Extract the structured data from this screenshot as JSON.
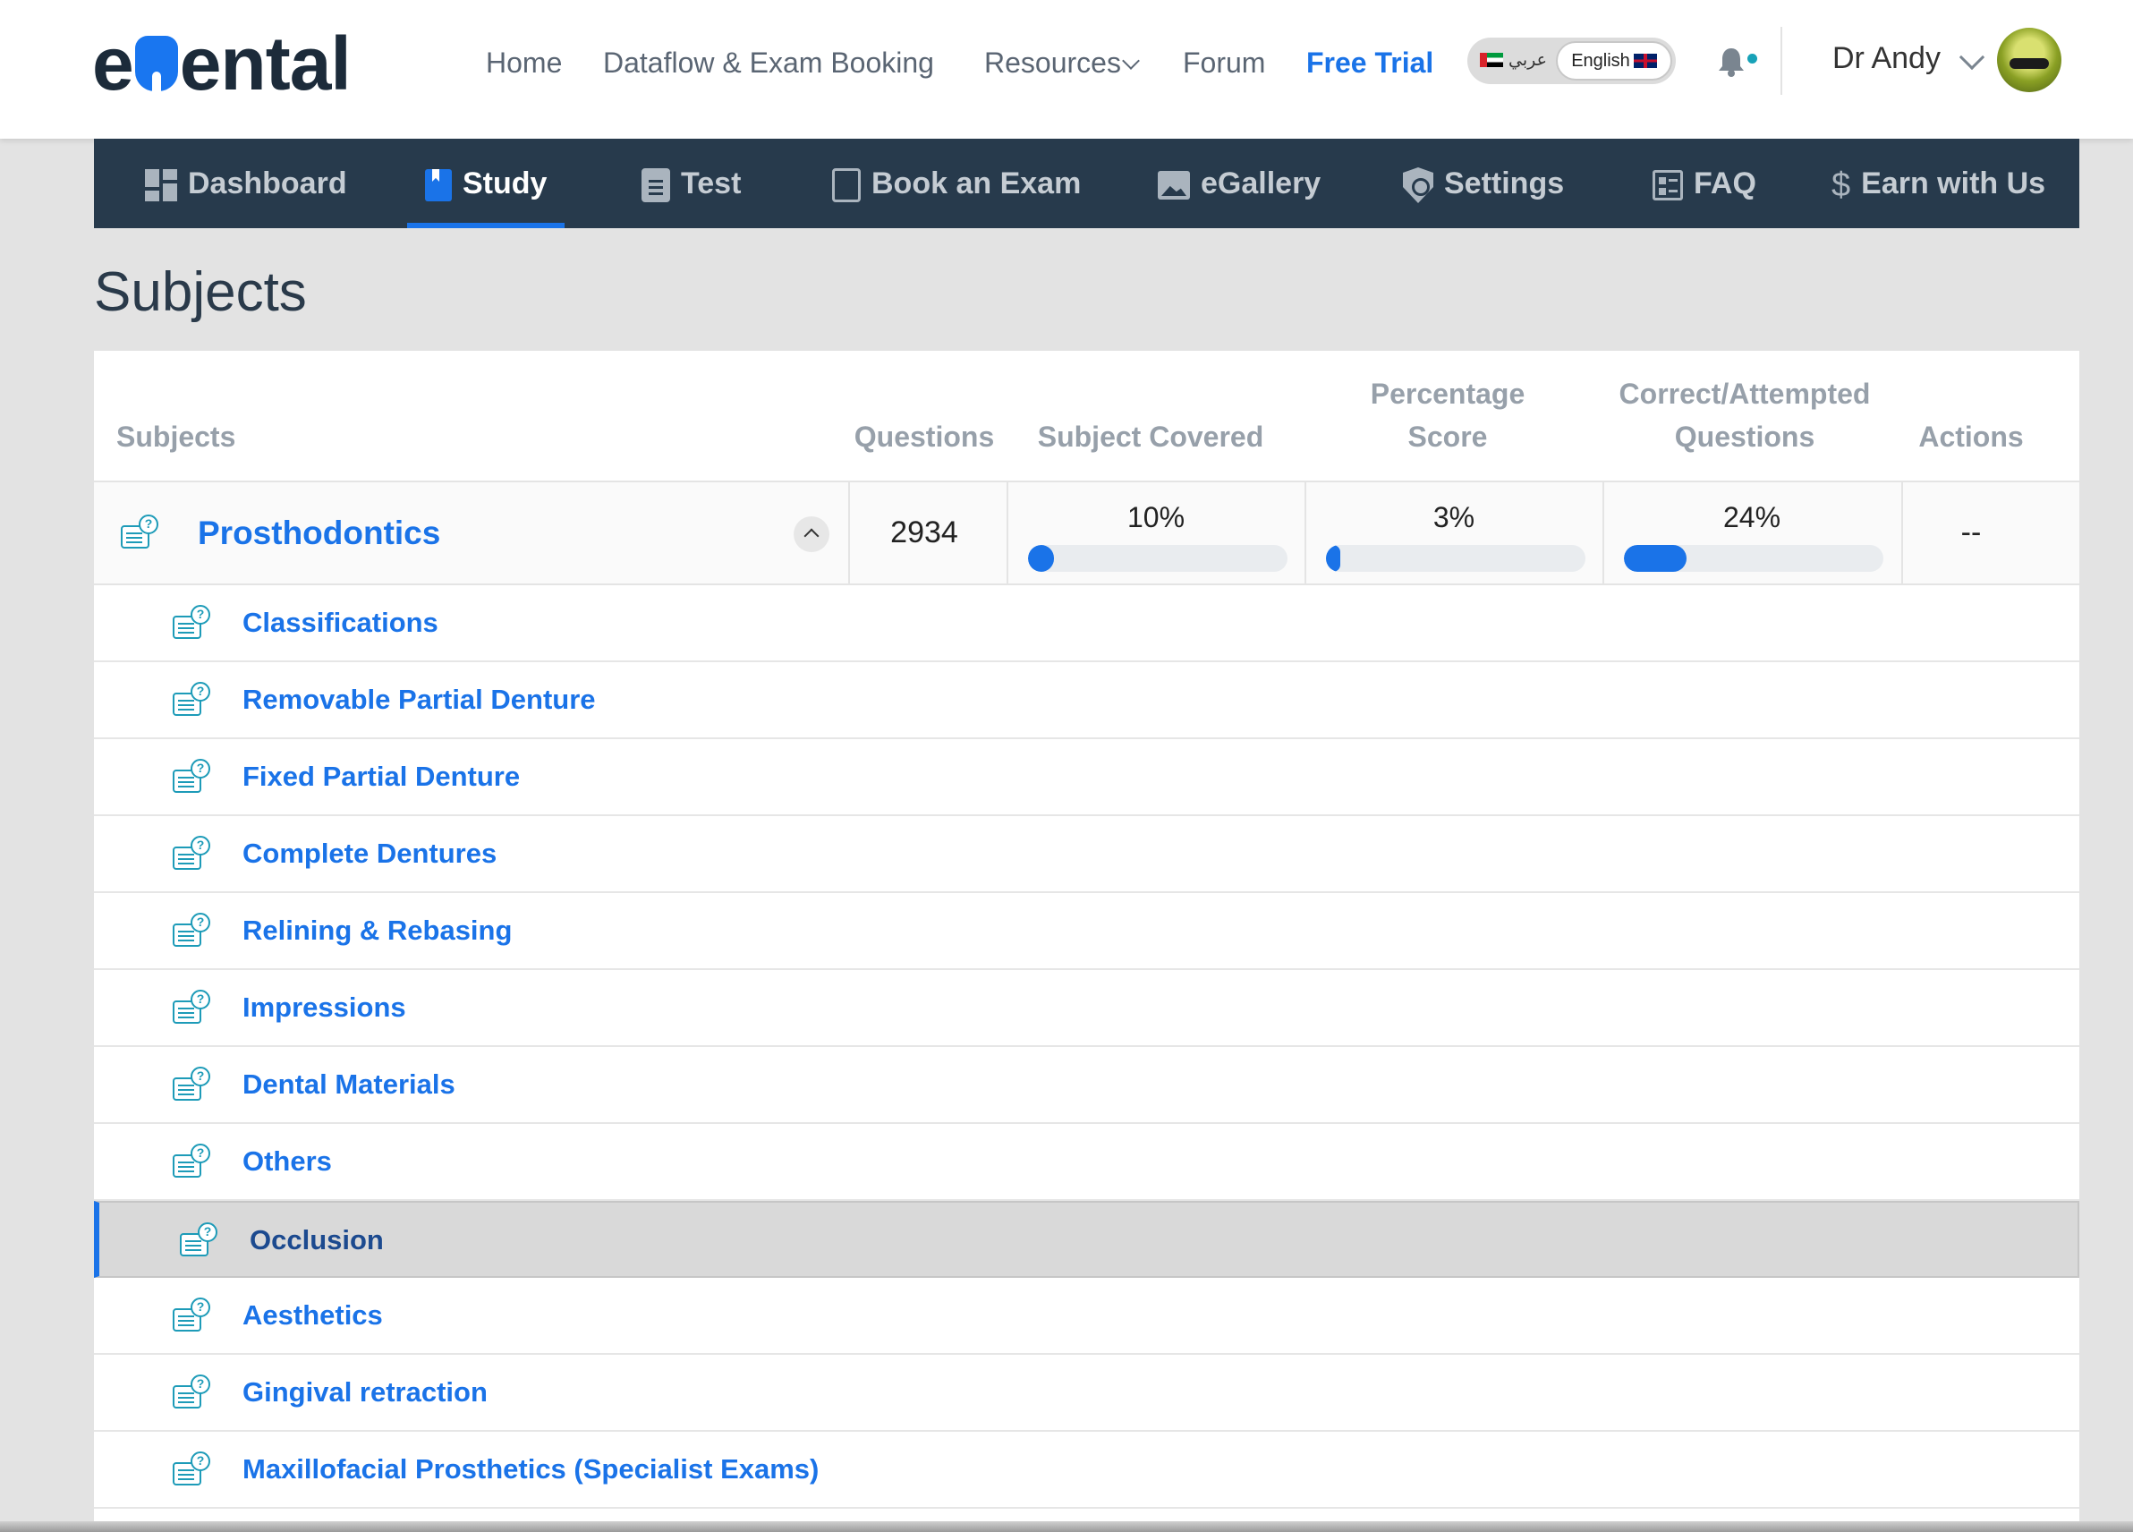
{
  "header": {
    "logo_text_left": "e",
    "logo_text_right": "ental",
    "links": [
      {
        "label": "Home"
      },
      {
        "label": "Dataflow & Exam Booking"
      },
      {
        "label": "Resources"
      },
      {
        "label": "Forum"
      },
      {
        "label": "Free Trial"
      }
    ],
    "lang_arabic": "عربي",
    "lang_english": "English",
    "user_name": "Dr Andy"
  },
  "mainnav": {
    "tabs": [
      {
        "label": "Dashboard",
        "icon": "dashboard-icon"
      },
      {
        "label": "Study",
        "icon": "book-icon",
        "active": true
      },
      {
        "label": "Test",
        "icon": "clipboard-icon"
      },
      {
        "label": "Book an Exam",
        "icon": "clipboard-outline-icon"
      },
      {
        "label": "eGallery",
        "icon": "image-icon"
      },
      {
        "label": "Settings",
        "icon": "shield-icon"
      },
      {
        "label": "FAQ",
        "icon": "faq-icon"
      },
      {
        "label": "Earn with Us",
        "icon": "dollar-icon"
      }
    ]
  },
  "page": {
    "title": "Subjects"
  },
  "table": {
    "headers": {
      "subjects": "Subjects",
      "questions": "Questions",
      "subject_covered": "Subject Covered",
      "percentage_score_1": "Percentage",
      "percentage_score_2": "Score",
      "correct_attempted_1": "Correct/Attempted",
      "correct_attempted_2": "Questions",
      "actions": "Actions"
    },
    "subject": {
      "name": "Prosthodontics",
      "questions": "2934",
      "subject_covered": "10%",
      "subject_covered_value": 0.1,
      "percentage_score": "3%",
      "percentage_score_value": 0.03,
      "correct_attempted": "24%",
      "correct_attempted_value": 0.24,
      "actions": "--"
    },
    "topics": [
      {
        "label": "Classifications"
      },
      {
        "label": "Removable Partial Denture"
      },
      {
        "label": "Fixed Partial Denture"
      },
      {
        "label": "Complete Dentures"
      },
      {
        "label": "Relining & Rebasing"
      },
      {
        "label": "Impressions"
      },
      {
        "label": "Dental Materials"
      },
      {
        "label": "Others"
      },
      {
        "label": "Occlusion",
        "selected": true
      },
      {
        "label": "Aesthetics"
      },
      {
        "label": "Gingival retraction"
      },
      {
        "label": "Maxillofacial Prosthetics (Specialist Exams)"
      }
    ]
  },
  "colors": {
    "accent": "#1a73e8",
    "nav_bg": "#273a4c",
    "page_bg": "#e3e3e3"
  }
}
